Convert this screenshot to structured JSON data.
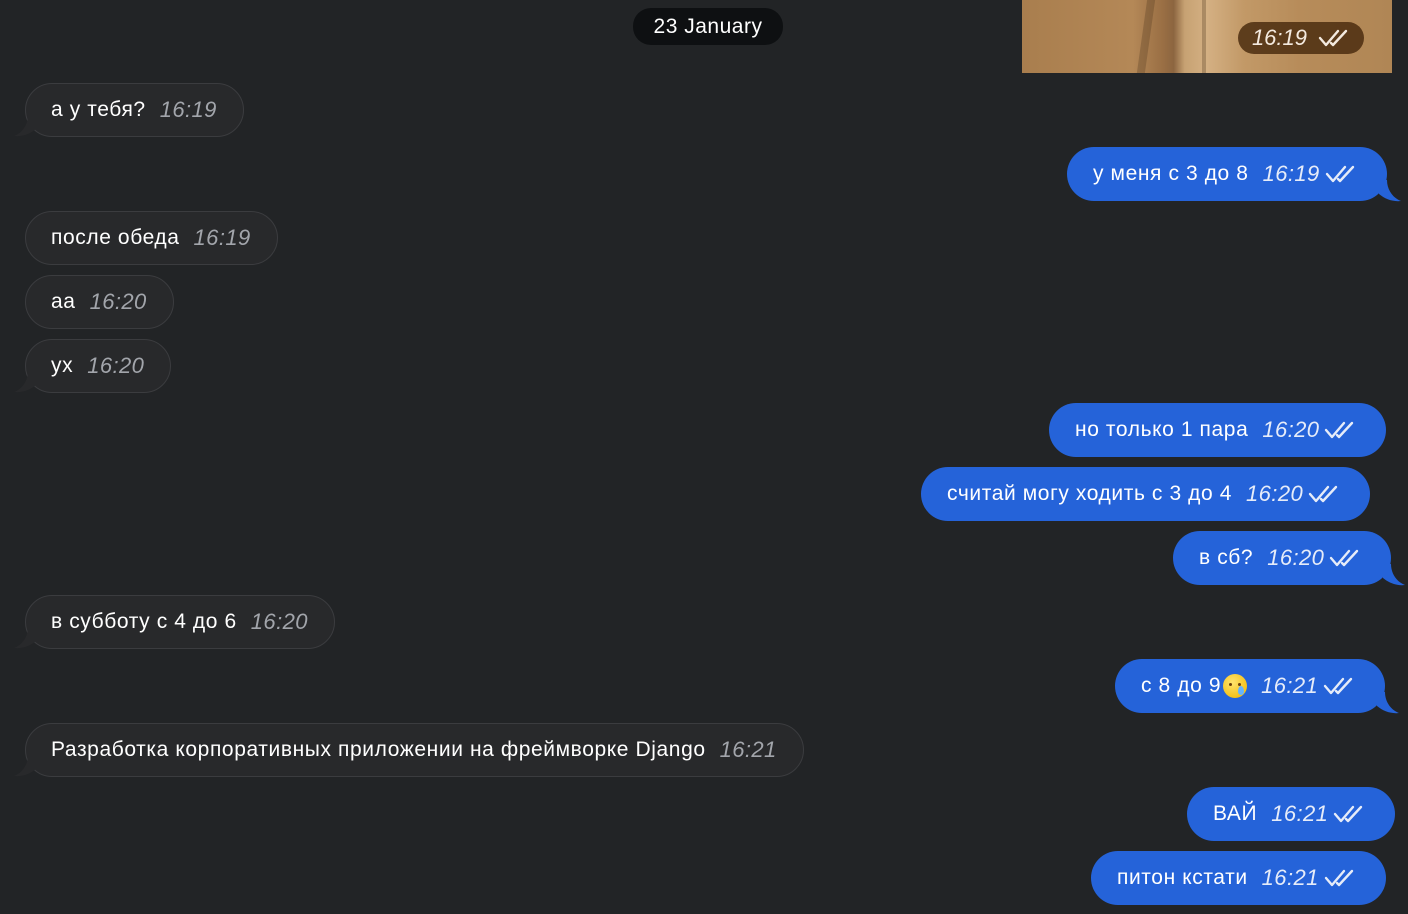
{
  "date_badge": "23 January",
  "photo": {
    "time": "16:19",
    "status": "read"
  },
  "messages": [
    {
      "direction": "incoming",
      "text": "а у тебя?",
      "time": "16:19"
    },
    {
      "direction": "outgoing",
      "text": "у меня с 3 до 8",
      "time": "16:19",
      "status": "read"
    },
    {
      "direction": "incoming",
      "text": "после обеда",
      "time": "16:19"
    },
    {
      "direction": "incoming",
      "text": "аа",
      "time": "16:20"
    },
    {
      "direction": "incoming",
      "text": "ух",
      "time": "16:20"
    },
    {
      "direction": "outgoing",
      "text": "но только 1 пара",
      "time": "16:20",
      "status": "read"
    },
    {
      "direction": "outgoing",
      "text": "считай могу ходить с 3 до 4",
      "time": "16:20",
      "status": "read"
    },
    {
      "direction": "outgoing",
      "text": "в сб?",
      "time": "16:20",
      "status": "read"
    },
    {
      "direction": "incoming",
      "text": "в субботу с 4 до 6",
      "time": "16:20"
    },
    {
      "direction": "outgoing",
      "text": "с 8 до 9",
      "emoji": "crying-face-emoji",
      "time": "16:21",
      "status": "read"
    },
    {
      "direction": "incoming",
      "text": "Разработка корпоративных приложении на фреймворке Django",
      "time": "16:21"
    },
    {
      "direction": "outgoing",
      "text": "ВАЙ",
      "time": "16:21",
      "status": "read"
    },
    {
      "direction": "outgoing",
      "text": "питон кстати",
      "time": "16:21",
      "status": "read"
    }
  ],
  "colors": {
    "background": "#222426",
    "incoming_bubble": "#28292b",
    "outgoing_bubble": "#2563d9",
    "date_badge": "#0e1012"
  }
}
